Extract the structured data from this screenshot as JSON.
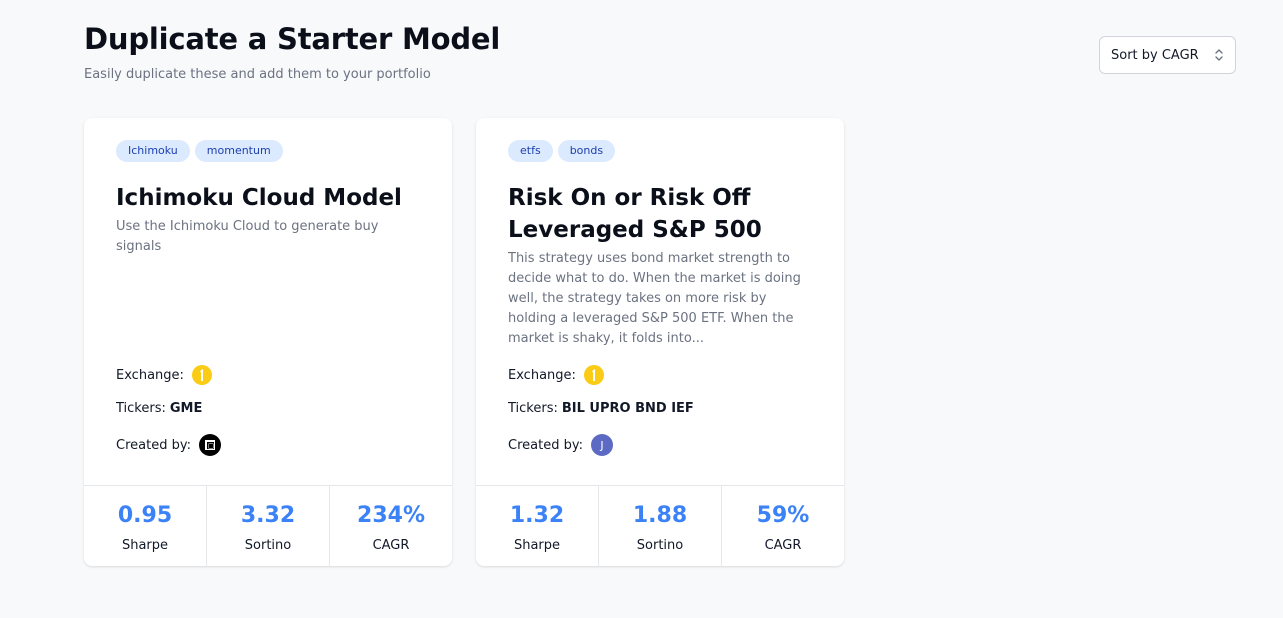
{
  "header": {
    "title": "Duplicate a Starter Model",
    "subtitle": "Easily duplicate these and add them to your portfolio"
  },
  "sort": {
    "label": "Sort by CAGR",
    "icon": "chevron-up-down-icon"
  },
  "labels": {
    "exchange": "Exchange:",
    "tickers": "Tickers:",
    "created_by": "Created by:"
  },
  "cards": [
    {
      "tags": [
        "Ichimoku",
        "momentum"
      ],
      "title": "Ichimoku Cloud Model",
      "description": "Use the Ichimoku Cloud to generate buy signals",
      "exchange_icon": "exchange-logo-icon",
      "tickers": "GME",
      "creator_avatar": "square-logo-avatar",
      "stats": [
        {
          "value": "0.95",
          "label": "Sharpe"
        },
        {
          "value": "3.32",
          "label": "Sortino"
        },
        {
          "value": "234%",
          "label": "CAGR"
        }
      ]
    },
    {
      "tags": [
        "etfs",
        "bonds"
      ],
      "title": "Risk On or Risk Off Leveraged S&P 500",
      "description": "This strategy uses bond market strength to decide what to do. When the market is doing well, the strategy takes on more risk by holding a leveraged S&P 500 ETF. When the market is shaky, it folds into...",
      "exchange_icon": "exchange-logo-icon",
      "tickers": "BIL UPRO BND IEF",
      "creator_avatar": "J",
      "stats": [
        {
          "value": "1.32",
          "label": "Sharpe"
        },
        {
          "value": "1.88",
          "label": "Sortino"
        },
        {
          "value": "59%",
          "label": "CAGR"
        }
      ]
    }
  ],
  "colors": {
    "accent": "#3b82f6",
    "tag_bg": "#dbeafe",
    "tag_text": "#1e40af",
    "exchange_yellow": "#facc15",
    "avatar_j": "#5c6ac4"
  }
}
